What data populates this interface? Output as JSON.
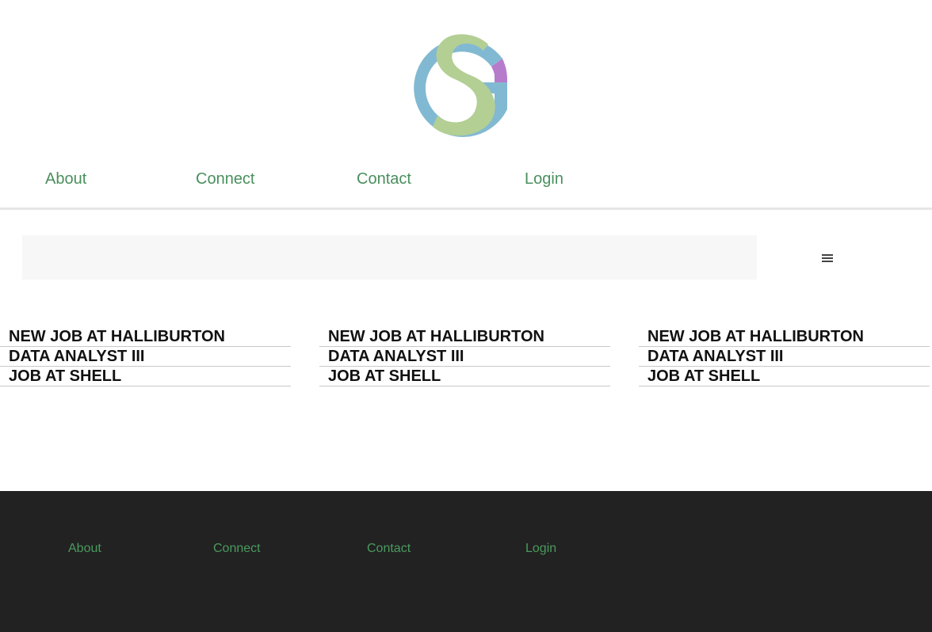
{
  "logo": {
    "icon": "sg-monogram-logo",
    "colors": {
      "ring": "#82b9d2",
      "letter": "#b3cf94",
      "accent": "#b77bcc"
    }
  },
  "top_nav": {
    "items": [
      {
        "label": "About"
      },
      {
        "label": "Connect"
      },
      {
        "label": "Contact"
      },
      {
        "label": "Login"
      }
    ]
  },
  "search": {
    "value": "",
    "placeholder": ""
  },
  "menu": {
    "icon": "hamburger-menu-icon"
  },
  "job_columns": [
    {
      "items": [
        "NEW JOB AT HALLIBURTON",
        "DATA ANALYST III",
        "JOB AT SHELL"
      ]
    },
    {
      "items": [
        "NEW JOB AT HALLIBURTON",
        "DATA ANALYST III",
        "JOB AT SHELL"
      ]
    },
    {
      "items": [
        "NEW JOB AT HALLIBURTON",
        "DATA ANALYST III",
        "JOB AT SHELL"
      ]
    }
  ],
  "footer": {
    "items": [
      {
        "label": "About"
      },
      {
        "label": "Connect"
      },
      {
        "label": "Contact"
      },
      {
        "label": "Login"
      }
    ]
  },
  "colors": {
    "link_green": "#4a8f5d",
    "footer_bg": "#222222"
  }
}
